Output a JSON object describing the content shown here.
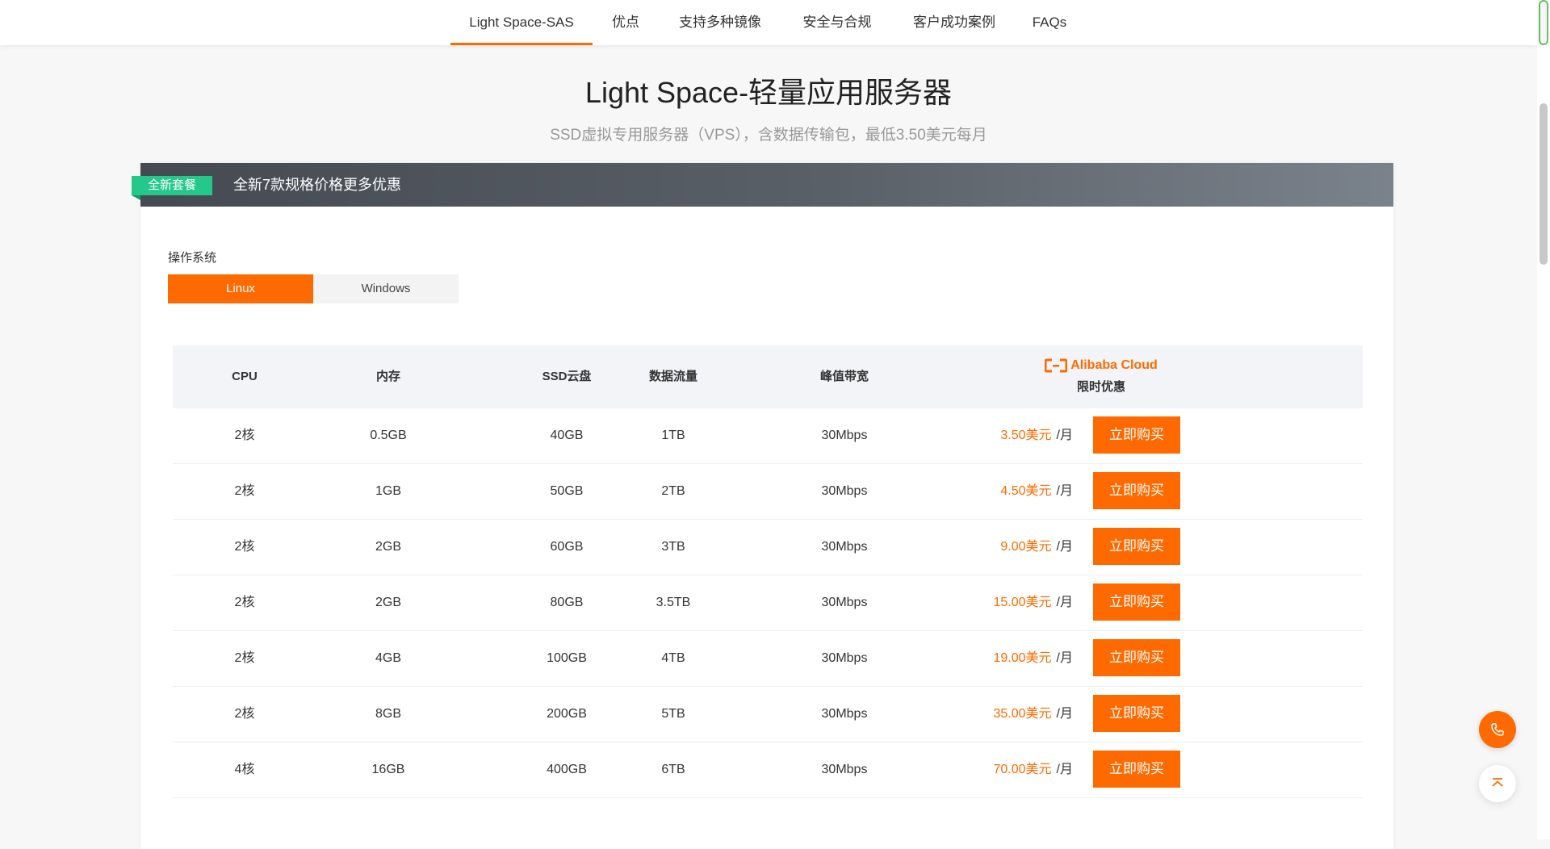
{
  "nav": {
    "tabs": [
      {
        "label": "Light Space-SAS"
      },
      {
        "label": "优点"
      },
      {
        "label": "支持多种镜像"
      },
      {
        "label": "安全与合规"
      },
      {
        "label": "客户成功案例"
      },
      {
        "label": "FAQs"
      }
    ],
    "active_index": 0
  },
  "hero": {
    "title": "Light Space-轻量应用服务器",
    "subtitle": "SSD虚拟专用服务器（VPS），含数据传输包，最低3.50美元每月"
  },
  "banner": {
    "badge": "全新套餐",
    "text": "全新7款规格价格更多优惠"
  },
  "os": {
    "label": "操作系统",
    "options": [
      "Linux",
      "Windows"
    ],
    "selected": "Linux"
  },
  "table": {
    "headers": {
      "cpu": "CPU",
      "memory": "内存",
      "ssd": "SSD云盘",
      "traffic": "数据流量",
      "bandwidth": "峰值带宽",
      "brand": "Alibaba Cloud",
      "promo": "限时优惠"
    },
    "per_unit": "/月",
    "buy_label": "立即购买",
    "rows": [
      {
        "cpu": "2核",
        "memory": "0.5GB",
        "ssd": "40GB",
        "traffic": "1TB",
        "bandwidth": "30Mbps",
        "price": "3.50美元"
      },
      {
        "cpu": "2核",
        "memory": "1GB",
        "ssd": "50GB",
        "traffic": "2TB",
        "bandwidth": "30Mbps",
        "price": "4.50美元"
      },
      {
        "cpu": "2核",
        "memory": "2GB",
        "ssd": "60GB",
        "traffic": "3TB",
        "bandwidth": "30Mbps",
        "price": "9.00美元"
      },
      {
        "cpu": "2核",
        "memory": "2GB",
        "ssd": "80GB",
        "traffic": "3.5TB",
        "bandwidth": "30Mbps",
        "price": "15.00美元"
      },
      {
        "cpu": "2核",
        "memory": "4GB",
        "ssd": "100GB",
        "traffic": "4TB",
        "bandwidth": "30Mbps",
        "price": "19.00美元"
      },
      {
        "cpu": "2核",
        "memory": "8GB",
        "ssd": "200GB",
        "traffic": "5TB",
        "bandwidth": "30Mbps",
        "price": "35.00美元"
      },
      {
        "cpu": "4核",
        "memory": "16GB",
        "ssd": "400GB",
        "traffic": "6TB",
        "bandwidth": "30Mbps",
        "price": "70.00美元"
      }
    ]
  },
  "colors": {
    "accent": "#ff6a00",
    "badge": "#24c88b",
    "banner_dark": "#454a52"
  },
  "icons": {
    "phone": "phone-icon",
    "back_to_top": "back-to-top-icon",
    "brand_logo": "alibaba-cloud-logo-icon"
  }
}
